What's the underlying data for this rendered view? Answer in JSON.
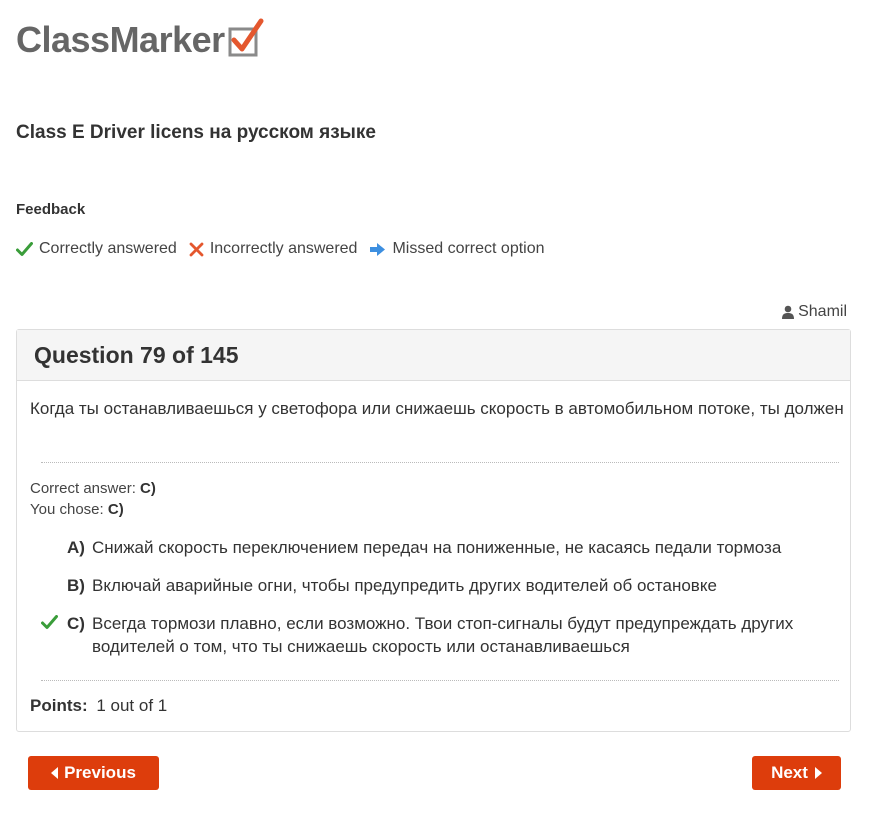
{
  "brand": {
    "logo_text": "ClassMarker"
  },
  "quiz": {
    "title": "Class E Driver licens на русском языке"
  },
  "feedback": {
    "heading": "Feedback",
    "legend": [
      {
        "icon": "check-icon",
        "label": "Correctly answered",
        "color": "#3a9d3a"
      },
      {
        "icon": "cross-icon",
        "label": "Incorrectly answered",
        "color": "#e4572e"
      },
      {
        "icon": "arrow-right-icon",
        "label": "Missed correct option",
        "color": "#3d8fe0"
      }
    ]
  },
  "user": {
    "icon": "user-icon",
    "name": "Shamil"
  },
  "question": {
    "header": "Question 79 of 145",
    "text": "Когда ты останавливаешься у светофора или снижаешь скорость в автомобильном потоке, ты должен",
    "correct_answer_label": "Correct answer:",
    "correct_answer_value": "C)",
    "you_chose_label": "You chose:",
    "you_chose_value": "C)",
    "options": [
      {
        "letter": "A)",
        "text": "Снижай скорость переключением передач на пониженные, не касаясь педали тормоза",
        "marked_correct": false
      },
      {
        "letter": "B)",
        "text": "Включай аварийные огни, чтобы предупредить других водителей об остановке",
        "marked_correct": false
      },
      {
        "letter": "C)",
        "text": "Всегда тормози плавно, если возможно. Твои стоп-сигналы будут предупреждать других водителей о том, что ты снижаешь скорость или останавливаешься",
        "marked_correct": true
      }
    ],
    "points_label": "Points:",
    "points_value": "1 out of 1"
  },
  "nav": {
    "previous_label": "Previous",
    "next_label": "Next",
    "button_color": "#dd3d0c"
  }
}
